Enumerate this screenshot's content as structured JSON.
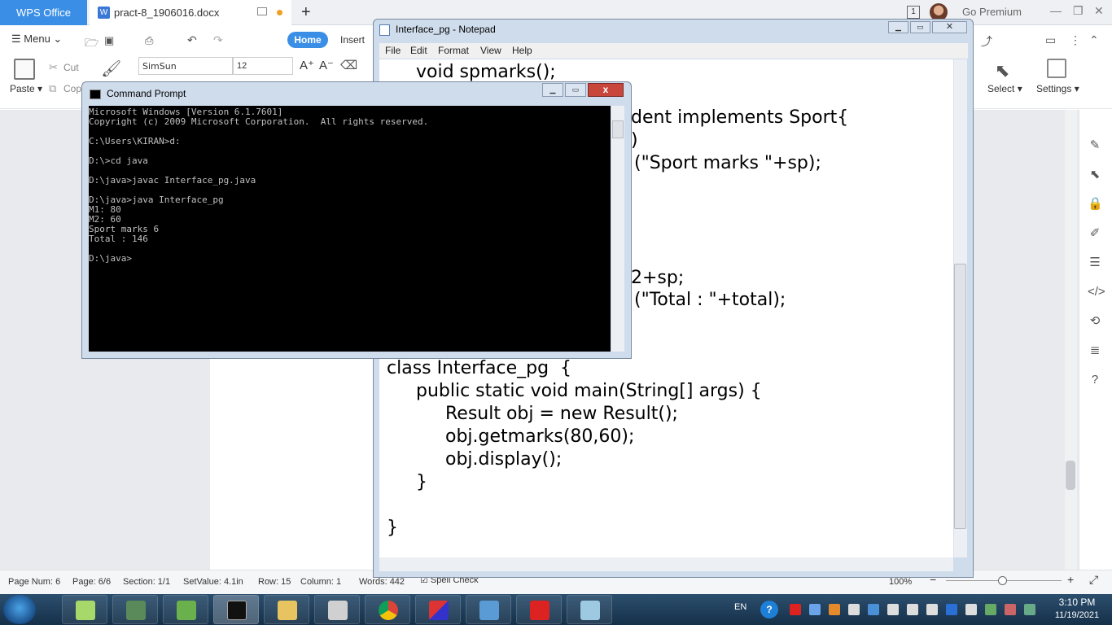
{
  "wps": {
    "home_tab": "WPS Office",
    "doc_tab": "pract-8_1906016.docx",
    "go_premium": "Go Premium",
    "tab_count": "1",
    "menu": "Menu",
    "tabs": {
      "home": "Home",
      "insert": "Insert"
    },
    "ribbon": {
      "paste": "Paste",
      "cut": "Cut",
      "copy": "Copy",
      "font_name": "SimSun",
      "font_size": "12",
      "select": "Select",
      "settings": "Settings"
    },
    "status": {
      "page_num": "Page Num: 6",
      "page": "Page: 6/6",
      "section": "Section: 1/1",
      "set_value": "SetValue: 4.1in",
      "row": "Row: 15",
      "column": "Column: 1",
      "words": "Words: 442",
      "spell_check": "Spell Check",
      "zoom": "100%"
    }
  },
  "notepad": {
    "title": "Interface_pg - Notepad",
    "menu": [
      "File",
      "Edit",
      "Format",
      "View",
      "Help"
    ],
    "lines": [
      "void spmarks();",
      "dent implements Sport{",
      ")",
      "(\"Sport marks \"+sp);",
      "2+sp;",
      "(\"Total : \"+total);",
      "class Interface_pg  {",
      "public static void main(String[] args) {",
      "Result obj = new Result();",
      "obj.getmarks(80,60);",
      "obj.display();",
      "}",
      "}"
    ]
  },
  "cmd": {
    "title": "Command Prompt",
    "close": "x",
    "lines": [
      "Microsoft Windows [Version 6.1.7601]",
      "Copyright (c) 2009 Microsoft Corporation.  All rights reserved.",
      "",
      "C:\\Users\\KIRAN>d:",
      "",
      "D:\\>cd java",
      "",
      "D:\\java>javac Interface_pg.java",
      "",
      "D:\\java>java Interface_pg",
      "M1: 80",
      "M2: 60",
      "Sport marks 6",
      "Total : 146",
      "",
      "D:\\java>"
    ]
  },
  "taskbar": {
    "lang": "EN",
    "time": "3:10 PM",
    "date": "11/19/2021"
  },
  "colors": {
    "wps_blue": "#3a8ee6",
    "taskbar": "#1f3f5e",
    "cmd_bg": "#000000",
    "cmd_text": "#c0c0c0"
  }
}
